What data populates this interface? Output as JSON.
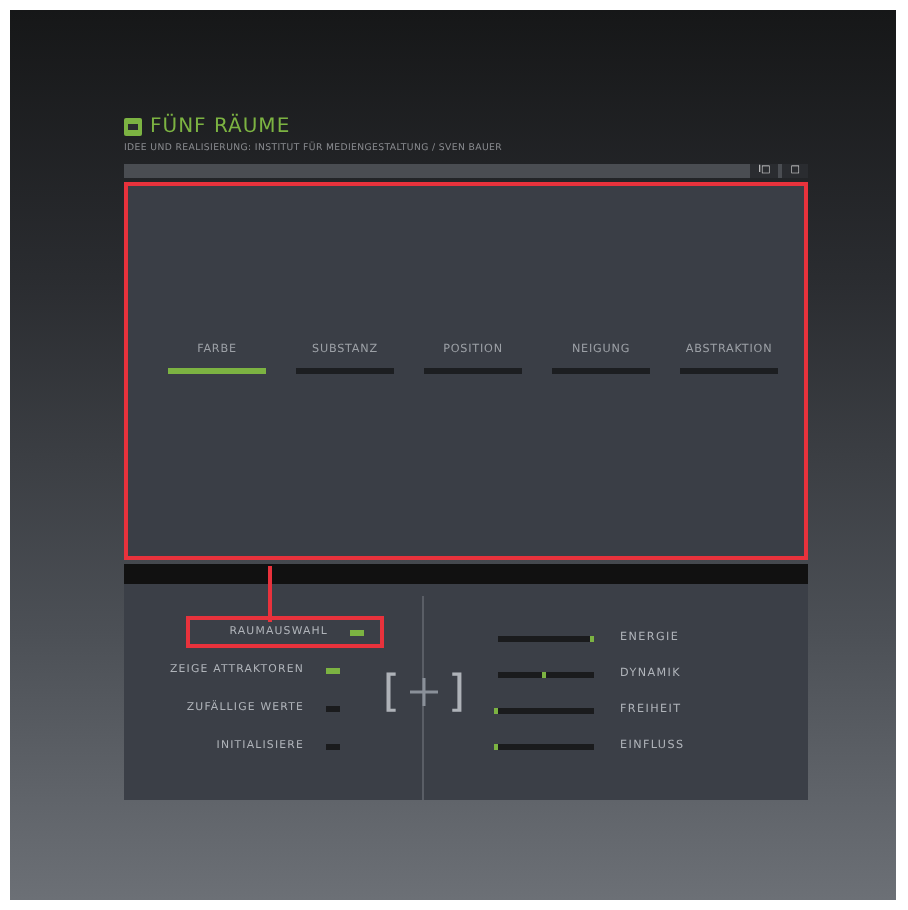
{
  "header": {
    "title": "FÜNF RÄUME",
    "subtitle": "IDEE UND REALISIERUNG: INSTITUT FÜR MEDIENGESTALTUNG / SVEN BAUER"
  },
  "toolbar": {
    "buttons": [
      "I□",
      "□"
    ]
  },
  "tabs": [
    {
      "label": "FARBE",
      "selected": true
    },
    {
      "label": "SUBSTANZ",
      "selected": false
    },
    {
      "label": "POSITION",
      "selected": false
    },
    {
      "label": "NEIGUNG",
      "selected": false
    },
    {
      "label": "ABSTRAKTION",
      "selected": false
    }
  ],
  "options": [
    {
      "label": "RAUMAUSWAHL",
      "on": true,
      "highlighted": true
    },
    {
      "label": "ZEIGE ATTRAKTOREN",
      "on": true,
      "highlighted": false
    },
    {
      "label": "ZUFÄLLIGE WERTE",
      "on": false,
      "highlighted": false
    },
    {
      "label": "INITIALISIERE",
      "on": false,
      "highlighted": false
    }
  ],
  "center": {
    "left": "[",
    "right": "]"
  },
  "sliders": [
    {
      "label": "ENERGIE",
      "level": 1
    },
    {
      "label": "DYNAMIK",
      "level": 0.5
    },
    {
      "label": "FREIHEIT",
      "level": 0
    },
    {
      "label": "EINFLUSS",
      "level": 0
    }
  ]
}
